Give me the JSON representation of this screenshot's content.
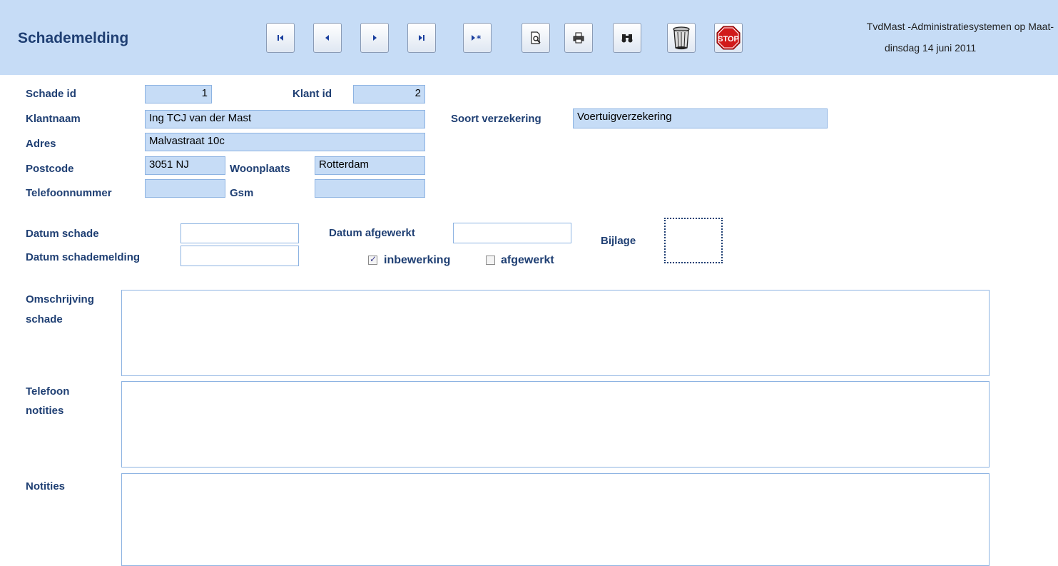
{
  "header": {
    "title": "Schademelding",
    "app_name": "TvdMast  -Administratiesystemen op Maat-",
    "date": "dinsdag 14 juni 2011",
    "buttons": [
      {
        "name": "first-record-button",
        "icon": "first-record-icon"
      },
      {
        "name": "previous-record-button",
        "icon": "previous-record-icon"
      },
      {
        "name": "next-record-button",
        "icon": "next-record-icon"
      },
      {
        "name": "last-record-button",
        "icon": "last-record-icon"
      },
      {
        "name": "new-record-button",
        "icon": "new-record-icon"
      },
      {
        "name": "print-preview-button",
        "icon": "print-preview-icon"
      },
      {
        "name": "print-button",
        "icon": "printer-icon"
      },
      {
        "name": "find-button",
        "icon": "binoculars-icon"
      },
      {
        "name": "delete-button",
        "icon": "trash-can-icon"
      },
      {
        "name": "close-button",
        "icon": "stop-sign-icon",
        "text": "STOP"
      }
    ]
  },
  "customer": {
    "schade_id_label": "Schade id",
    "schade_id": "1",
    "klant_id_label": "Klant id",
    "klant_id": "2",
    "klantnaam_label": "Klantnaam",
    "klantnaam": "Ing TCJ van der Mast",
    "soort_label": "Soort verzekering",
    "soort": "Voertuigverzekering",
    "adres_label": "Adres",
    "adres": "Malvastraat 10c",
    "postcode_label": "Postcode",
    "postcode": "3051 NJ",
    "woonplaats_label": "Woonplaats",
    "woonplaats": "Rotterdam",
    "telefoon_label": "Telefoonnummer",
    "telefoon": "",
    "gsm_label": "Gsm",
    "gsm": ""
  },
  "claim": {
    "datum_schade_label": "Datum schade",
    "datum_schade": "",
    "datum_schademelding_label": "Datum schademelding",
    "datum_schademelding": "",
    "datum_afgewerkt_label": "Datum afgewerkt",
    "datum_afgewerkt": "",
    "inbewerking_label": "inbewerking",
    "inbewerking_checked": true,
    "afgewerkt_label": "afgewerkt",
    "afgewerkt_checked": false,
    "bijlage_label": "Bijlage"
  },
  "notes": {
    "omschrijving_label_1": "Omschrijving",
    "omschrijving_label_2": "schade",
    "telefoon_notities_label_1": "Telefoon",
    "telefoon_notities_label_2": "notities",
    "notities_label": "Notities"
  },
  "colors": {
    "header_bg": "#c6dcf6",
    "label_text": "#1f3f73",
    "field_bg": "#c6dcf6",
    "field_border": "#8db3e2",
    "stop_red": "#d11a1a"
  }
}
